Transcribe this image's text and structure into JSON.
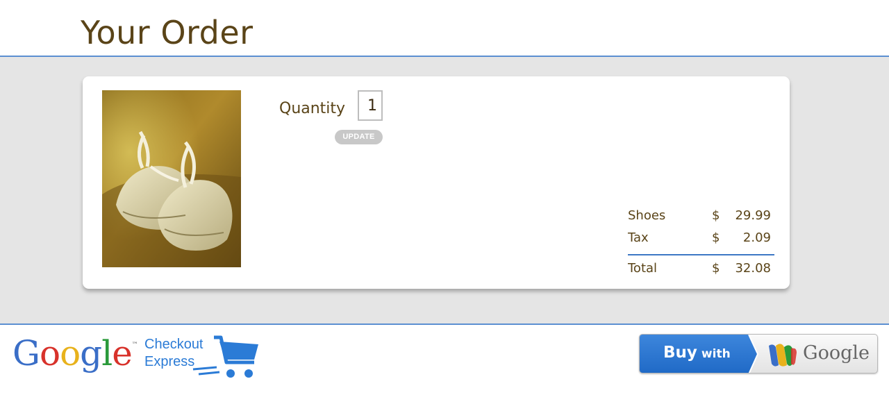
{
  "header": {
    "title": "Your Order"
  },
  "product": {
    "image_icon": "baby-shoes-photo",
    "quantity_label": "Quantity",
    "quantity_value": "1",
    "update_label": "UPDATE"
  },
  "totals": [
    {
      "label": "Shoes",
      "currency": "$",
      "amount": "29.99"
    },
    {
      "label": "Tax",
      "currency": "$",
      "amount": "2.09"
    },
    {
      "label": "Total",
      "currency": "$",
      "amount": "32.08"
    }
  ],
  "footer": {
    "logo_letters": [
      "G",
      "o",
      "o",
      "g",
      "l",
      "e"
    ],
    "logo_tm": "™",
    "checkout_line1": "Checkout",
    "checkout_line2": "Express",
    "cart_icon": "shopping-cart-icon",
    "buy_button": {
      "buy": "Buy",
      "with": "with",
      "brand": "Google",
      "wallet_icon": "google-wallet-icon"
    }
  },
  "colors": {
    "title": "#5a4418",
    "accent_blue": "#2b7bd6",
    "divider_blue": "#5b8fd1",
    "band_gray": "#e5e5e5",
    "google_blue": "#3a6ec7",
    "google_red": "#d8322b",
    "google_yellow": "#e8b21c",
    "google_green": "#2a9a3a"
  }
}
